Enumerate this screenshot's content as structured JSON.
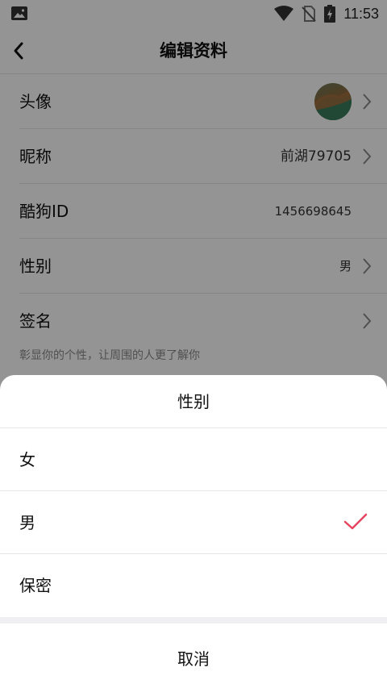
{
  "status_bar": {
    "time": "11:53",
    "icons": [
      "image-icon",
      "wifi-icon",
      "no-sim-icon",
      "battery-charging-icon"
    ]
  },
  "header": {
    "title": "编辑资料",
    "back_icon": "chevron-left-icon"
  },
  "profile": {
    "rows": [
      {
        "label": "头像",
        "value": "",
        "type": "avatar"
      },
      {
        "label": "昵称",
        "value": "前湖79705"
      },
      {
        "label": "酷狗ID",
        "value": "1456698645"
      },
      {
        "label": "性别",
        "value": "男"
      },
      {
        "label": "签名",
        "value": ""
      }
    ],
    "signature_hint": "彰显你的个性，让周围的人更了解你"
  },
  "gender_sheet": {
    "title": "性别",
    "options": [
      "女",
      "男",
      "保密"
    ],
    "selected": "男",
    "cancel_label": "取消",
    "accent_color": "#e8455f"
  }
}
